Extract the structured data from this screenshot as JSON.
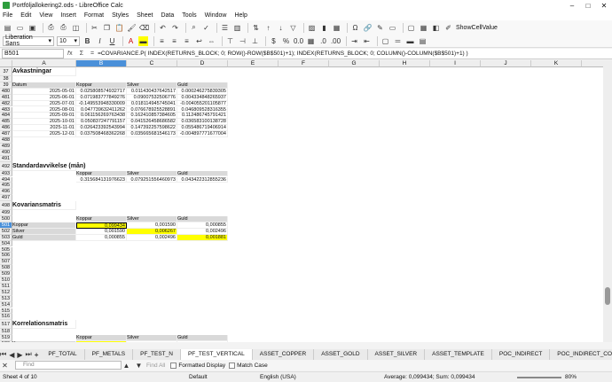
{
  "window": {
    "title": "Portföljallokering2.ods - LibreOffice Calc"
  },
  "menu": [
    "File",
    "Edit",
    "View",
    "Insert",
    "Format",
    "Styles",
    "Sheet",
    "Data",
    "Tools",
    "Window",
    "Help"
  ],
  "toolbar": {
    "font_name": "Liberation Sans",
    "font_size": "10",
    "showcellvalue": "ShowCellValue"
  },
  "formula_bar": {
    "name_box": "B501",
    "formula": "=COVARIANCE.P(     INDEX(RETURNS_BLOCK; 0; ROW()-ROW($B$501)+1);     INDEX(RETURNS_BLOCK; 0; COLUMN()-COLUMN($B$501)+1) )"
  },
  "columns": [
    "A",
    "B",
    "C",
    "D",
    "E",
    "F",
    "G",
    "H",
    "I",
    "J",
    "K",
    "L",
    "M"
  ],
  "rows": {
    "r37": {
      "num": "37",
      "a": "Avkastningar"
    },
    "r38": {
      "num": "38"
    },
    "r39": {
      "num": "39",
      "a": "Datum",
      "b": "Koppar",
      "c": "Silver",
      "d": "Guld"
    },
    "data": [
      {
        "num": "480",
        "date": "2025-05-01",
        "b": "0.025808574932717",
        "c": "0.011430437642517",
        "d": "0.000246275839305"
      },
      {
        "num": "481",
        "date": "2025-06-01",
        "b": "0.071983777849276",
        "c": "0.09007532506776",
        "d": "0.004334848265937"
      },
      {
        "num": "482",
        "date": "2025-07-01",
        "b": "-0.149553948330009",
        "c": "0.018114945745041",
        "d": "-0.004055201105877"
      },
      {
        "num": "483",
        "date": "2025-08-01",
        "b": "0.047739632411262",
        "c": "0.076678925528891",
        "d": "0.046809528316355"
      },
      {
        "num": "484",
        "date": "2025-09-01",
        "b": "0.061156269763438",
        "c": "0.162410857384605",
        "d": "0.112486745791421"
      },
      {
        "num": "485",
        "date": "2025-10-01",
        "b": "0.050837247791157",
        "c": "0.041526458686582",
        "d": "0.036583100138728"
      },
      {
        "num": "486",
        "date": "2025-11-01",
        "b": "0.026423392543994",
        "c": "0.147392257598622",
        "d": "0.055486719406914"
      },
      {
        "num": "487",
        "date": "2025-12-01",
        "b": "0.037508468362268",
        "c": "0.035665681546173",
        "d": "-0.004897771677004"
      }
    ],
    "empty1": [
      "488",
      "489",
      "490",
      "491"
    ],
    "r492": {
      "num": "492",
      "a": "Standardavvikelse (mån)"
    },
    "r493": {
      "num": "493",
      "b": "Koppar",
      "c": "Silver",
      "d": "Guld"
    },
    "r494": {
      "num": "494",
      "b": "0.315684131976623",
      "c": "0.079251556460973",
      "d": "0.043422312855236"
    },
    "empty2": [
      "495",
      "496",
      "497"
    ],
    "r498": {
      "num": "498",
      "a": "Kovariansmatris"
    },
    "r499": {
      "num": "499"
    },
    "r500": {
      "num": "500",
      "b": "Koppar",
      "c": "Silver",
      "d": "Guld"
    },
    "cov": [
      {
        "num": "501",
        "a": "Koppar",
        "b": "0,099434",
        "c": "0,001590",
        "d": "0,000855"
      },
      {
        "num": "502",
        "a": "Silver",
        "b": "0,001590",
        "c": "0,006267",
        "d": "0,002496"
      },
      {
        "num": "503",
        "a": "Guld",
        "b": "0,000855",
        "c": "0,002496",
        "d": "0,001881"
      }
    ],
    "empty3": [
      "504",
      "505",
      "506",
      "507",
      "508",
      "509",
      "510",
      "511",
      "512",
      "513",
      "514",
      "515",
      "516"
    ],
    "r517": {
      "num": "517",
      "a": "Korrelationsmatris"
    },
    "r518": {
      "num": "518"
    },
    "r519": {
      "num": "519",
      "b": "Koppar",
      "c": "Silver",
      "d": "Guld"
    },
    "corr": [
      {
        "num": "520",
        "a": "Koppar"
      },
      {
        "num": "521",
        "a": "Silver"
      },
      {
        "num": "522",
        "a": "Guld"
      }
    ]
  },
  "tabs": [
    "PF_TOTAL",
    "PF_METALS",
    "PF_TEST_N",
    "PF_TEST_VERTICAL",
    "ASSET_COPPER",
    "ASSET_GOLD",
    "ASSET_SILVER",
    "ASSET_TEMPLATE",
    "POC_INDIRECT",
    "POC_INDIRECT_COPY"
  ],
  "find": {
    "placeholder": "Find",
    "find_all": "Find All",
    "formatted_display": "Formatted Display",
    "match_case": "Match Case"
  },
  "status": {
    "sheet": "Sheet 4 of 10",
    "style": "Default",
    "language": "English (USA)",
    "summary": "Average: 0,099434; Sum: 0,099434",
    "zoom": "80%"
  },
  "colors": {
    "selected_header": "#4a90d9",
    "highlight": "#ffff00",
    "tab_active": "#ffffff"
  }
}
